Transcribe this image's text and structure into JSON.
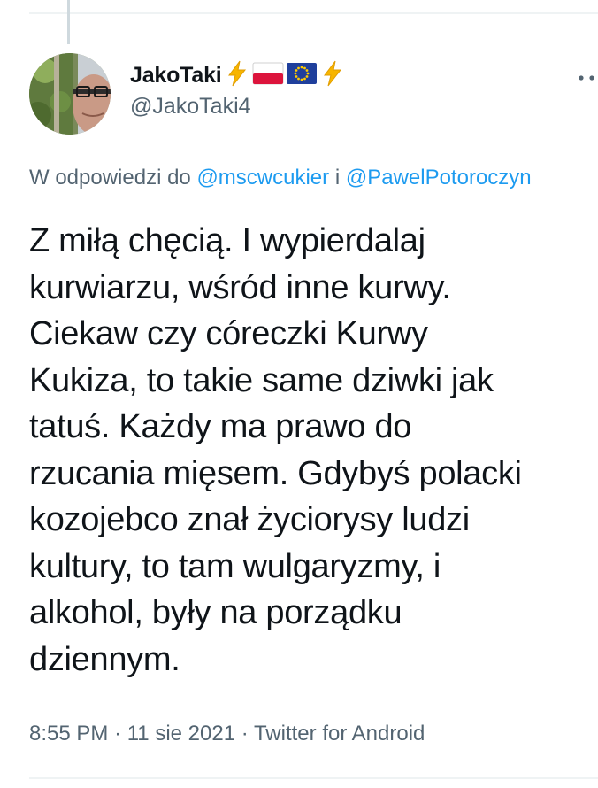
{
  "tweet": {
    "author": {
      "display_name": "JakoTaki",
      "handle": "@JakoTaki4",
      "name_emojis": [
        "lightning-emoji",
        "flag-poland",
        "flag-eu",
        "lightning-emoji"
      ]
    },
    "reply_context": {
      "prefix": "W odpowiedzi do",
      "mention_1": "@mscwcukier",
      "connector": "i",
      "mention_2": "@PawelPotoroczyn"
    },
    "text": "Z miłą chęcią. I wypierdalaj\nkurwiarzu, wśród inne kurwy.\nCiekaw czy córeczki Kurwy\nKukiza, to takie same dziwki jak\ntatuś. Każdy ma prawo do\nrzucania mięsem. Gdybyś polacki\nkozojebco znał życiorysy ludzi\nkultury, to tam wulgaryzmy, i\nalkohol, były na porządku\ndziennym.",
    "meta": {
      "time": "8:55 PM",
      "date": "11 sie 2021",
      "client": "Twitter for Android",
      "separator": "·"
    }
  },
  "colors": {
    "text": "#0f1419",
    "secondary": "#536471",
    "link": "#1d9bf0",
    "divider": "#eff3f4"
  }
}
